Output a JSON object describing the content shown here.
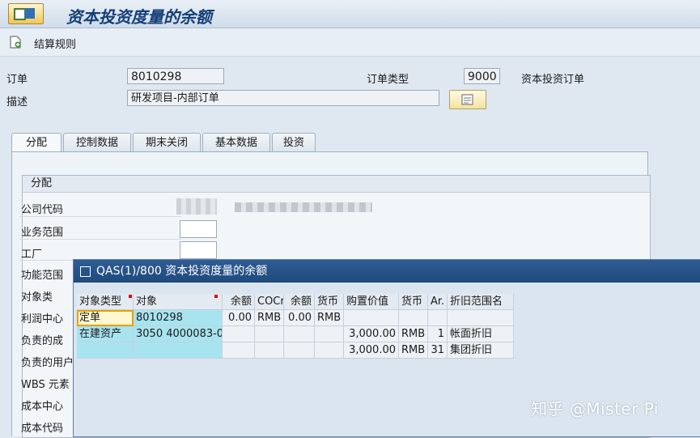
{
  "window": {
    "title": "资本投资度量的余额"
  },
  "toolbar": {
    "settlement_rule": "结算规则"
  },
  "header": {
    "order_label": "订单",
    "order_value": "8010298",
    "order_type_label": "订单类型",
    "order_type_value": "9000",
    "order_type_text": "资本投资订单",
    "desc_label": "描述",
    "desc_value": "研发项目-内部订单"
  },
  "tabs": [
    "分配",
    "控制数据",
    "期末关闭",
    "基本数据",
    "投资"
  ],
  "panel": {
    "group_title": "分配",
    "rows": [
      "公司代码",
      "业务范围",
      "工厂",
      "功能范围",
      "对象类",
      "利润中心",
      "负责的成",
      "负责的用户",
      "WBS 元素",
      "成本中心",
      "成本代码"
    ]
  },
  "popup": {
    "title": "QAS(1)/800 资本投资度量的余额",
    "headers": [
      "对象类型",
      "对象",
      "余额",
      "COCr",
      "余额",
      "货币",
      "购置价值",
      "货币",
      "Ar.",
      "折旧范围名"
    ],
    "rows": [
      [
        "定单",
        "8010298",
        "0.00",
        "RMB",
        "0.00",
        "RMB",
        "",
        "",
        "",
        ""
      ],
      [
        "在建资产",
        "3050 4000083-0",
        "",
        "",
        "",
        "",
        "3,000.00",
        "RMB",
        "1",
        "帐面折旧"
      ],
      [
        "",
        "",
        "",
        "",
        "",
        "",
        "3,000.00",
        "RMB",
        "31",
        "集团折旧"
      ]
    ]
  },
  "watermark": "知乎 @Mister Pi"
}
